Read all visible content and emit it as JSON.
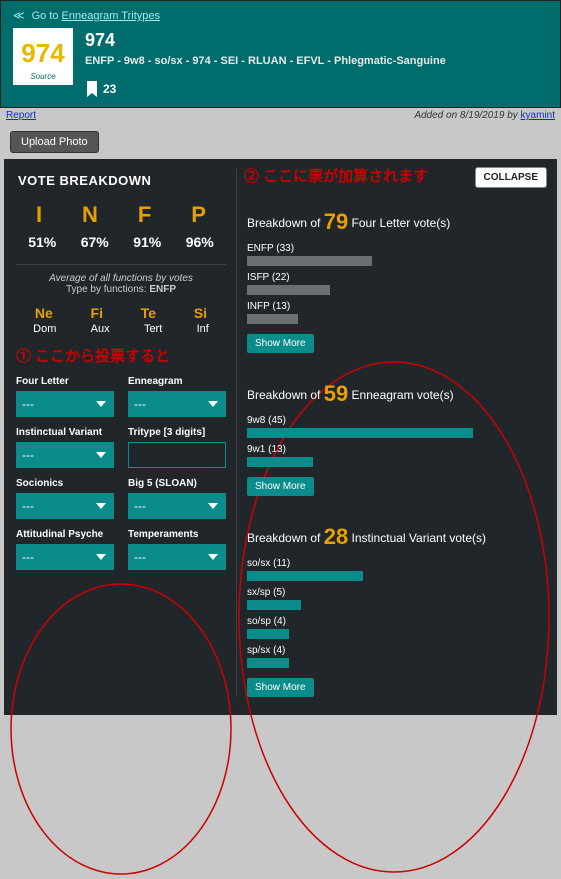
{
  "header": {
    "go_to_prefix": "Go to ",
    "go_to_link": "Enneagram Tritypes",
    "arrows": "≪",
    "avatar_number": "974",
    "avatar_source": "Source",
    "title": "974",
    "subtitle": "ENFP - 9w8 - so/sx - 974 - SEI - RLUAN - EFVL - Phlegmatic-Sanguine",
    "bookmark_count": "23"
  },
  "meta": {
    "report": "Report",
    "added_prefix": "Added on ",
    "added_date": "8/19/2019",
    "by": " by ",
    "user": "kyamint"
  },
  "upload_label": "Upload Photo",
  "vote_title": "VOTE BREAKDOWN",
  "collapse_label": "COLLAPSE",
  "annotations": {
    "one": "①  ここから投票すると",
    "two": "② ここに票が加算されます"
  },
  "letters": [
    "I",
    "N",
    "F",
    "P"
  ],
  "percents": [
    "51%",
    "67%",
    "91%",
    "96%"
  ],
  "avg_line": "Average of all functions by votes",
  "type_by_line_prefix": "Type by functions: ",
  "type_by_value": "ENFP",
  "functions": [
    "Ne",
    "Fi",
    "Te",
    "Si"
  ],
  "positions": [
    "Dom",
    "Aux",
    "Tert",
    "Inf"
  ],
  "form": {
    "four_letter": "Four Letter",
    "enneagram": "Enneagram",
    "instinct": "Instinctual Variant",
    "tritype": "Tritype [3 digits]",
    "socionics": "Socionics",
    "big5": "Big 5 (SLOAN)",
    "att_psyche": "Attitudinal Psyche",
    "temperaments": "Temperaments",
    "placeholder": "---",
    "tritype_ph": ""
  },
  "show_more": "Show More",
  "breakdowns": {
    "fourletter": {
      "prefix": "Breakdown of ",
      "count": "79",
      "suffix": " Four Letter vote(s)",
      "rows": [
        {
          "label": "ENFP",
          "count": "(33)",
          "pct": 42,
          "grey": true
        },
        {
          "label": "ISFP",
          "count": "(22)",
          "pct": 28,
          "grey": true
        },
        {
          "label": "INFP",
          "count": "(13)",
          "pct": 17,
          "grey": true
        }
      ]
    },
    "enneagram": {
      "prefix": "Breakdown of ",
      "count": "59",
      "suffix": " Enneagram vote(s)",
      "rows": [
        {
          "label": "9w8",
          "count": "(45)",
          "pct": 76
        },
        {
          "label": "9w1",
          "count": "(13)",
          "pct": 22
        }
      ]
    },
    "instinct": {
      "prefix": "Breakdown of ",
      "count": "28",
      "suffix": " Instinctual Variant vote(s)",
      "rows": [
        {
          "label": "so/sx",
          "count": "(11)",
          "pct": 39
        },
        {
          "label": "sx/sp",
          "count": "(5)",
          "pct": 18
        },
        {
          "label": "so/sp",
          "count": "(4)",
          "pct": 14
        },
        {
          "label": "sp/sx",
          "count": "(4)",
          "pct": 14
        }
      ]
    }
  }
}
